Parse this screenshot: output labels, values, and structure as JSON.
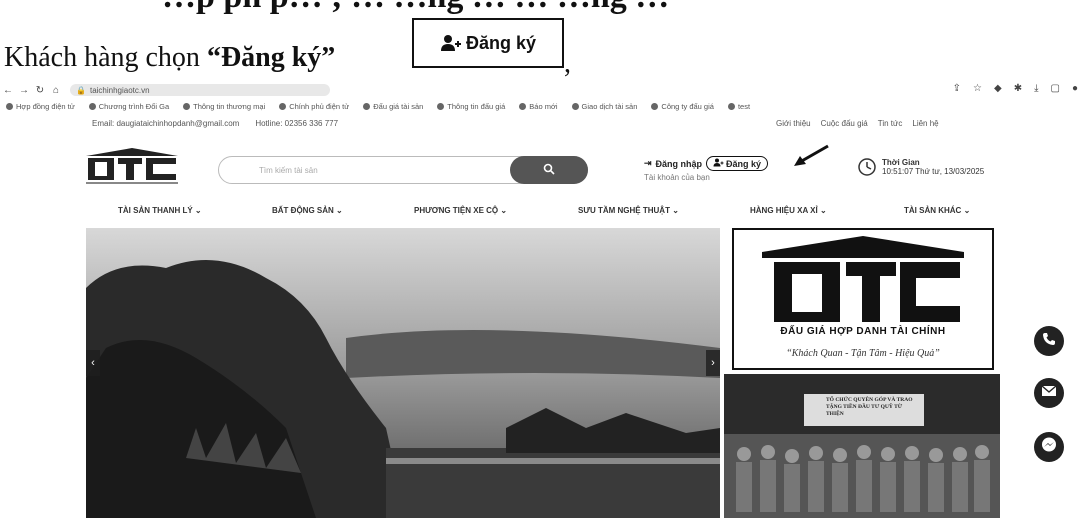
{
  "document": {
    "heading_fragment": "…p ph p… ; … …ng … … …ng …",
    "instruction_prefix": "Khách hàng chọn ",
    "instruction_quoted": "“Đăng ký”",
    "instruction_suffix": ",",
    "register_button_label": "Đăng ký"
  },
  "browser": {
    "back_icon": "back-arrow-icon",
    "url": "taichinhgiaotc.vn",
    "bookmarks": [
      "Hợp đồng điện tử",
      "Chương trình Đổi Ga",
      "Thông tin thương mại",
      "Chính phủ điện tử",
      "Đấu giá tài sản",
      "Thông tin đấu giá",
      "Báo mới",
      "Giao dịch tài sản",
      "Công ty đấu giá",
      "test"
    ]
  },
  "site": {
    "topbar_email": "Email: daugiataichinhopdanh@gmail.com",
    "topbar_hotline": "Hotline: 02356 336 777",
    "topbar_links": [
      "Giới thiệu",
      "Cuộc đấu giá",
      "Tin tức",
      "Liên hệ"
    ],
    "search_placeholder": "Tìm kiếm tài sản",
    "login_label": "Đăng nhập",
    "register_label": "Đăng ký",
    "account_label": "Tài khoản của bạn",
    "time_title": "Thời Gian",
    "time_value": "10:51:07 Thứ tư, 13/03/2025",
    "menu": [
      "TÀI SẢN THANH LÝ",
      "BẤT ĐỘNG SẢN",
      "PHƯƠNG TIỆN XE CỘ",
      "SƯU TẦM NGHỆ THUẬT",
      "HÀNG HIỆU XA XỈ",
      "TÀI SẢN KHÁC"
    ],
    "ad_brand": "ĐẤU GIÁ HỢP DANH TÀI CHÍNH",
    "ad_slogan": "“Khách Quan - Tận Tâm - Hiệu Quả”",
    "photo_banner": "TỔ CHỨC QUYÊN GÓP VÀ TRAO TẶNG TIỀN ĐẦU TƯ QUỸ TỪ THIỆN"
  },
  "colors": {
    "accent_dark": "#555555",
    "text": "#111111"
  }
}
